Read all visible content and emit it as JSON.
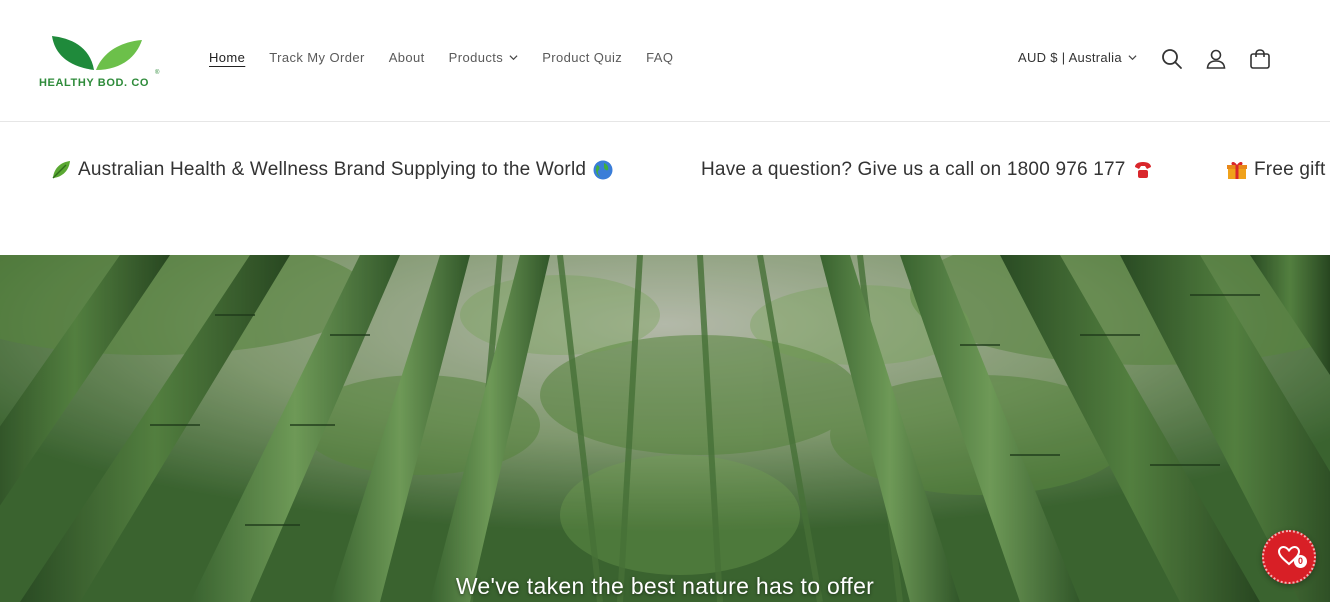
{
  "brand": {
    "logo_text": "HEALTHY BOD. CO",
    "registered_mark": "®",
    "accent_color": "#2e8b3a"
  },
  "nav": {
    "items": [
      {
        "label": "Home",
        "active": true
      },
      {
        "label": "Track My Order"
      },
      {
        "label": "About"
      },
      {
        "label": "Products",
        "has_dropdown": true
      },
      {
        "label": "Product Quiz"
      },
      {
        "label": "FAQ"
      }
    ]
  },
  "header_tools": {
    "locale_label": "AUD $ | Australia",
    "icons": [
      "search-icon",
      "account-icon",
      "cart-icon"
    ]
  },
  "announcements": [
    {
      "text": "Australian Health & Wellness Brand Supplying to the World",
      "icons": [
        "leaf-icon",
        "globe-icon"
      ]
    },
    {
      "text": "Have a question? Give us a call on 1800 976 177",
      "icons": [
        "phone-icon"
      ]
    },
    {
      "text": "Free gift",
      "icons": [
        "gift-icon"
      ]
    }
  ],
  "hero": {
    "caption": "We've taken the best nature has to offer"
  },
  "wishlist": {
    "count": "0",
    "color": "#d81f26"
  }
}
